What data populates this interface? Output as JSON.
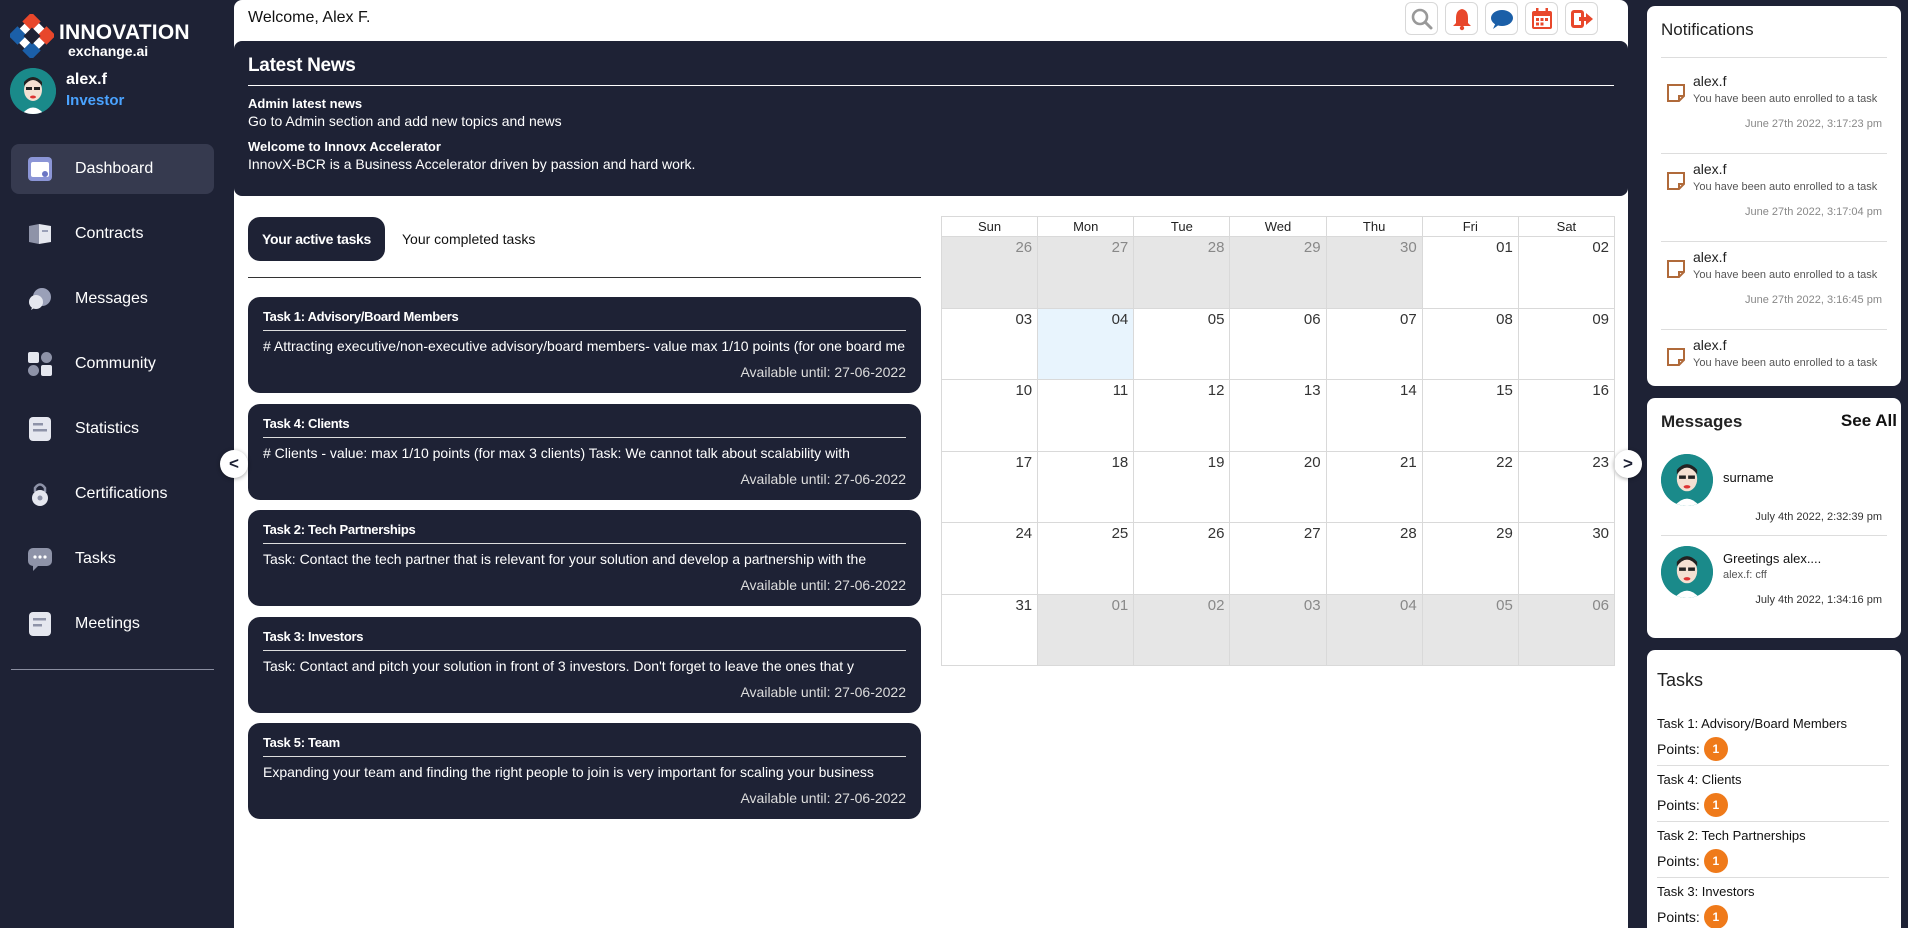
{
  "brand": {
    "title": "INNOVATION",
    "subtitle": "exchange.ai"
  },
  "user": {
    "name": "alex.f",
    "role": "Investor"
  },
  "nav": [
    {
      "label": "Dashboard",
      "icon": "dashboard-icon",
      "active": true
    },
    {
      "label": "Contracts",
      "icon": "contracts-icon"
    },
    {
      "label": "Messages",
      "icon": "messages-icon"
    },
    {
      "label": "Community",
      "icon": "community-icon"
    },
    {
      "label": "Statistics",
      "icon": "statistics-icon"
    },
    {
      "label": "Certifications",
      "icon": "certifications-icon"
    },
    {
      "label": "Tasks",
      "icon": "tasks-icon"
    },
    {
      "label": "Meetings",
      "icon": "meetings-icon"
    }
  ],
  "topbar": {
    "welcome": "Welcome, Alex F.",
    "icons": [
      "search-icon",
      "bell-icon",
      "chat-icon",
      "calendar-icon",
      "logout-icon"
    ]
  },
  "news": {
    "title": "Latest News",
    "items": [
      {
        "title": "Admin latest news",
        "body": "Go to Admin section and add new topics and news"
      },
      {
        "title": "Welcome to Innovx Accelerator",
        "body": "InnovX-BCR is a Business Accelerator driven by passion and hard work."
      }
    ]
  },
  "task_tabs": {
    "active": "Your active tasks",
    "inactive": "Your completed tasks"
  },
  "tasks": [
    {
      "title": "Task 1: Advisory/Board Members",
      "desc": "# Attracting executive/non-executive advisory/board members- value max 1/10 points (for one board me",
      "until": "Available until: 27-06-2022"
    },
    {
      "title": "Task 4: Clients",
      "desc": "# Clients - value: max 1/10 points (for max 3 clients) Task: We cannot talk about scalability with",
      "until": "Available until: 27-06-2022"
    },
    {
      "title": "Task 2: Tech Partnerships",
      "desc": "Task: Contact the tech partner that is relevant for your solution and develop a partnership with the",
      "until": "Available until: 27-06-2022"
    },
    {
      "title": "Task 3: Investors",
      "desc": "Task: Contact and pitch your solution in front of 3 investors. Don't forget to leave the ones that y",
      "until": "Available until: 27-06-2022"
    },
    {
      "title": "Task 5: Team",
      "desc": "Expanding your team and finding the right people to join is very important for scaling your business",
      "until": "Available until: 27-06-2022"
    }
  ],
  "arrows": {
    "prev": "<",
    "next": ">"
  },
  "calendar": {
    "days": [
      "Sun",
      "Mon",
      "Tue",
      "Wed",
      "Thu",
      "Fri",
      "Sat"
    ],
    "weeks": [
      [
        {
          "d": "26",
          "o": 1
        },
        {
          "d": "27",
          "o": 1
        },
        {
          "d": "28",
          "o": 1
        },
        {
          "d": "29",
          "o": 1
        },
        {
          "d": "30",
          "o": 1
        },
        {
          "d": "01"
        },
        {
          "d": "02"
        }
      ],
      [
        {
          "d": "03"
        },
        {
          "d": "04",
          "t": 1
        },
        {
          "d": "05"
        },
        {
          "d": "06"
        },
        {
          "d": "07"
        },
        {
          "d": "08"
        },
        {
          "d": "09"
        }
      ],
      [
        {
          "d": "10"
        },
        {
          "d": "11"
        },
        {
          "d": "12"
        },
        {
          "d": "13"
        },
        {
          "d": "14"
        },
        {
          "d": "15"
        },
        {
          "d": "16"
        }
      ],
      [
        {
          "d": "17"
        },
        {
          "d": "18"
        },
        {
          "d": "19"
        },
        {
          "d": "20"
        },
        {
          "d": "21"
        },
        {
          "d": "22"
        },
        {
          "d": "23"
        }
      ],
      [
        {
          "d": "24"
        },
        {
          "d": "25"
        },
        {
          "d": "26"
        },
        {
          "d": "27"
        },
        {
          "d": "28"
        },
        {
          "d": "29"
        },
        {
          "d": "30"
        }
      ],
      [
        {
          "d": "31"
        },
        {
          "d": "01",
          "o": 1
        },
        {
          "d": "02",
          "o": 1
        },
        {
          "d": "03",
          "o": 1
        },
        {
          "d": "04",
          "o": 1
        },
        {
          "d": "05",
          "o": 1
        },
        {
          "d": "06",
          "o": 1
        }
      ]
    ]
  },
  "notifications": {
    "title": "Notifications",
    "items": [
      {
        "name": "alex.f",
        "text": "You have been auto enrolled to a task",
        "time": "June 27th 2022, 3:17:23 pm"
      },
      {
        "name": "alex.f",
        "text": "You have been auto enrolled to a task",
        "time": "June 27th 2022, 3:17:04 pm"
      },
      {
        "name": "alex.f",
        "text": "You have been auto enrolled to a task",
        "time": "June 27th 2022, 3:16:45 pm"
      },
      {
        "name": "alex.f",
        "text": "You have been auto enrolled to a task",
        "time": ""
      }
    ]
  },
  "messages": {
    "title": "Messages",
    "see_all": "See All",
    "items": [
      {
        "name": "surname",
        "sub": "",
        "time": "July 4th 2022, 2:32:39 pm"
      },
      {
        "name": "Greetings alex....",
        "sub": "alex.f: cff",
        "time": "July 4th 2022, 1:34:16 pm"
      }
    ]
  },
  "tasks_panel": {
    "title": "Tasks",
    "points_label": "Points:",
    "items": [
      {
        "name": "Task 1: Advisory/Board Members",
        "points": "1"
      },
      {
        "name": "Task 4: Clients",
        "points": "1"
      },
      {
        "name": "Task 2: Tech Partnerships",
        "points": "1"
      },
      {
        "name": "Task 3: Investors",
        "points": "1"
      }
    ]
  },
  "colors": {
    "navy": "#1e2235",
    "accent_orange": "#ef7a1a",
    "alert_red": "#e8472b",
    "chat_blue": "#1b5fa8",
    "role_blue": "#4aa3ff"
  }
}
